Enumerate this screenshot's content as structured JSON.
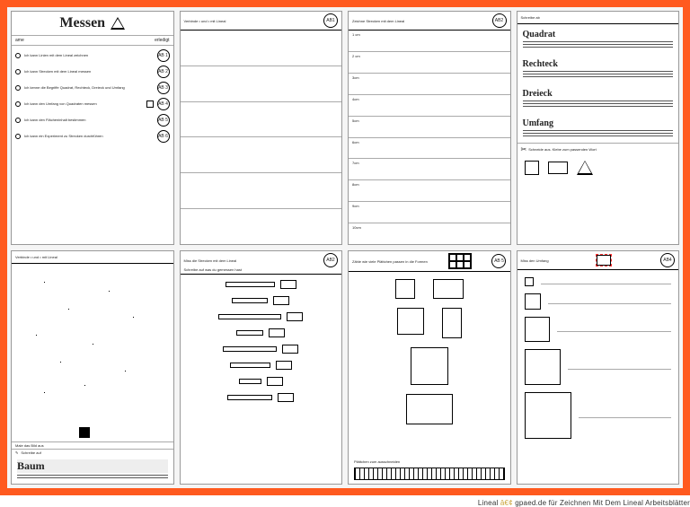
{
  "caption_plain": "Lineal ",
  "caption_gold": "â€¢ ",
  "caption_rest": "gpaed.de für Zeichnen Mit Dem Lineal Arbeitsblätter",
  "sheet1": {
    "title": "Messen",
    "name_label": "ame",
    "done_label": "erledigt",
    "tasks": [
      {
        "text": "Ich kann Linien mit dem Lineal zeichnen",
        "ab": "AB 1"
      },
      {
        "text": "Ich kann Strecken mit dem Lineal messen",
        "ab": "AB 2"
      },
      {
        "text": "Ich kenne die Begriffe Quadrat, Rechteck, Dreieck und Umfang",
        "ab": "AB 3"
      },
      {
        "text": "Ich kann den Umfang von Quadraten messen",
        "ab": "AB 4"
      },
      {
        "text": "Ich kann den Flächeninhalt bestimmen",
        "ab": "AB 5"
      },
      {
        "text": "Ich kann ein Experiment zu Strecken durchführen",
        "ab": "AB 6"
      }
    ]
  },
  "sheet2": {
    "head": "Verbinde • und • mit Lineal",
    "badge": "AB1"
  },
  "sheet3": {
    "head": "Zeichne Strecken mit dem Lineal",
    "badge": "AB2",
    "rows": [
      "1 cm",
      "2 cm",
      "3cm",
      "4cm",
      "5cm",
      "6cm",
      "7cm",
      "8cm",
      "9cm",
      "10cm"
    ]
  },
  "sheet4": {
    "head": "Schreibe ab",
    "words": [
      "Quadrat",
      "Rechteck",
      "Dreieck",
      "Umfang"
    ],
    "cut_label": "Schneide aus. Klebe         zum passenden Wort"
  },
  "sheet5": {
    "head": "Verbinde • und • mit Lineal",
    "sub1": "Male das Bild aus",
    "sub2": "Schreibe auf",
    "word": "Baum"
  },
  "sheet6": {
    "head1": "Miss die Strecken mit dem Lineal",
    "head2": "Schreibe auf was du gemessen hast",
    "badge": "AB2"
  },
  "sheet7": {
    "head": "Zähle wie viele Plättchen passen in die Formen",
    "badge": "AB 5",
    "footer": "Plättchen zum ausschneiden"
  },
  "sheet8": {
    "head": "Miss          den Umfang",
    "badge": "AB4"
  }
}
